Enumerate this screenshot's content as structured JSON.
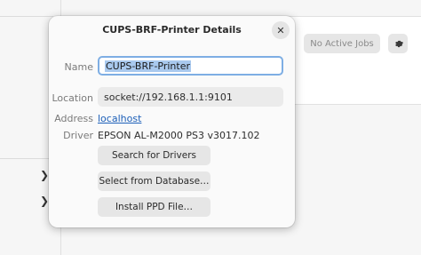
{
  "background": {
    "jobs_label": "No Active Jobs",
    "settings_icon": "gear-icon",
    "expand_icon": "chevron-right-icon"
  },
  "dialog": {
    "title": "CUPS-BRF-Printer Details",
    "close_icon": "close-icon",
    "name_label": "Name",
    "name_value": "CUPS-BRF-Printer",
    "location_label": "Location",
    "location_value": "socket://192.168.1.1:9101",
    "address_label": "Address",
    "address_value": "localhost",
    "driver_label": "Driver",
    "driver_value": "EPSON AL-M2000 PS3 v3017.102",
    "search_drivers_label": "Search for Drivers",
    "select_database_label": "Select from Database…",
    "install_ppd_label": "Install PPD File…"
  },
  "colors": {
    "accent": "#7eaee4",
    "selection": "#a9c9ee",
    "link": "#1c5fb8"
  }
}
